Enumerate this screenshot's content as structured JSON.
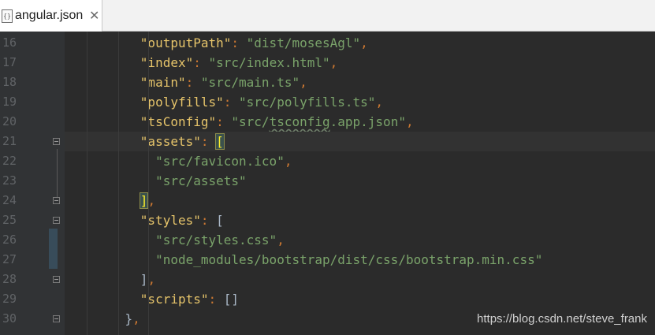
{
  "tab": {
    "icon_text": "{}",
    "file_name": "angular.json",
    "close_glyph": "✕"
  },
  "editor": {
    "lines": [
      {
        "num": "16",
        "indent": "      ",
        "key": "\"outputPath\"",
        "colon": ": ",
        "value": "\"dist/mosesAgl\"",
        "comma": ","
      },
      {
        "num": "17",
        "indent": "      ",
        "key": "\"index\"",
        "colon": ": ",
        "value": "\"src/index.html\"",
        "comma": ","
      },
      {
        "num": "18",
        "indent": "      ",
        "key": "\"main\"",
        "colon": ": ",
        "value": "\"src/main.ts\"",
        "comma": ","
      },
      {
        "num": "19",
        "indent": "      ",
        "key": "\"polyfills\"",
        "colon": ": ",
        "value": "\"src/polyfills.ts\"",
        "comma": ","
      },
      {
        "num": "20",
        "indent": "      ",
        "key": "\"tsConfig\"",
        "colon": ": ",
        "value_pre": "\"src/",
        "value_typo": "tsconfig",
        "value_post": ".app.json\"",
        "comma": ","
      },
      {
        "num": "21",
        "indent": "      ",
        "key": "\"assets\"",
        "colon": ": ",
        "bracket": "[",
        "bracket_match": true,
        "current": true
      },
      {
        "num": "22",
        "indent": "        ",
        "value": "\"src/favicon.ico\"",
        "comma": ","
      },
      {
        "num": "23",
        "indent": "        ",
        "value": "\"src/assets\""
      },
      {
        "num": "24",
        "indent": "      ",
        "bracket": "]",
        "bracket_match": true,
        "comma": ","
      },
      {
        "num": "25",
        "indent": "      ",
        "key": "\"styles\"",
        "colon": ": ",
        "bracket": "["
      },
      {
        "num": "26",
        "indent": "        ",
        "value": "\"src/styles.css\"",
        "comma": ","
      },
      {
        "num": "27",
        "indent": "        ",
        "value": "\"node_modules/bootstrap/dist/css/bootstrap.min.css\""
      },
      {
        "num": "28",
        "indent": "      ",
        "bracket": "]",
        "comma": ","
      },
      {
        "num": "29",
        "indent": "      ",
        "key": "\"scripts\"",
        "colon": ": ",
        "bracket": "[]"
      },
      {
        "num": "30",
        "indent": "    ",
        "bracket": "}",
        "comma": ","
      }
    ]
  },
  "watermark": "https://blog.csdn.net/steve_frank"
}
